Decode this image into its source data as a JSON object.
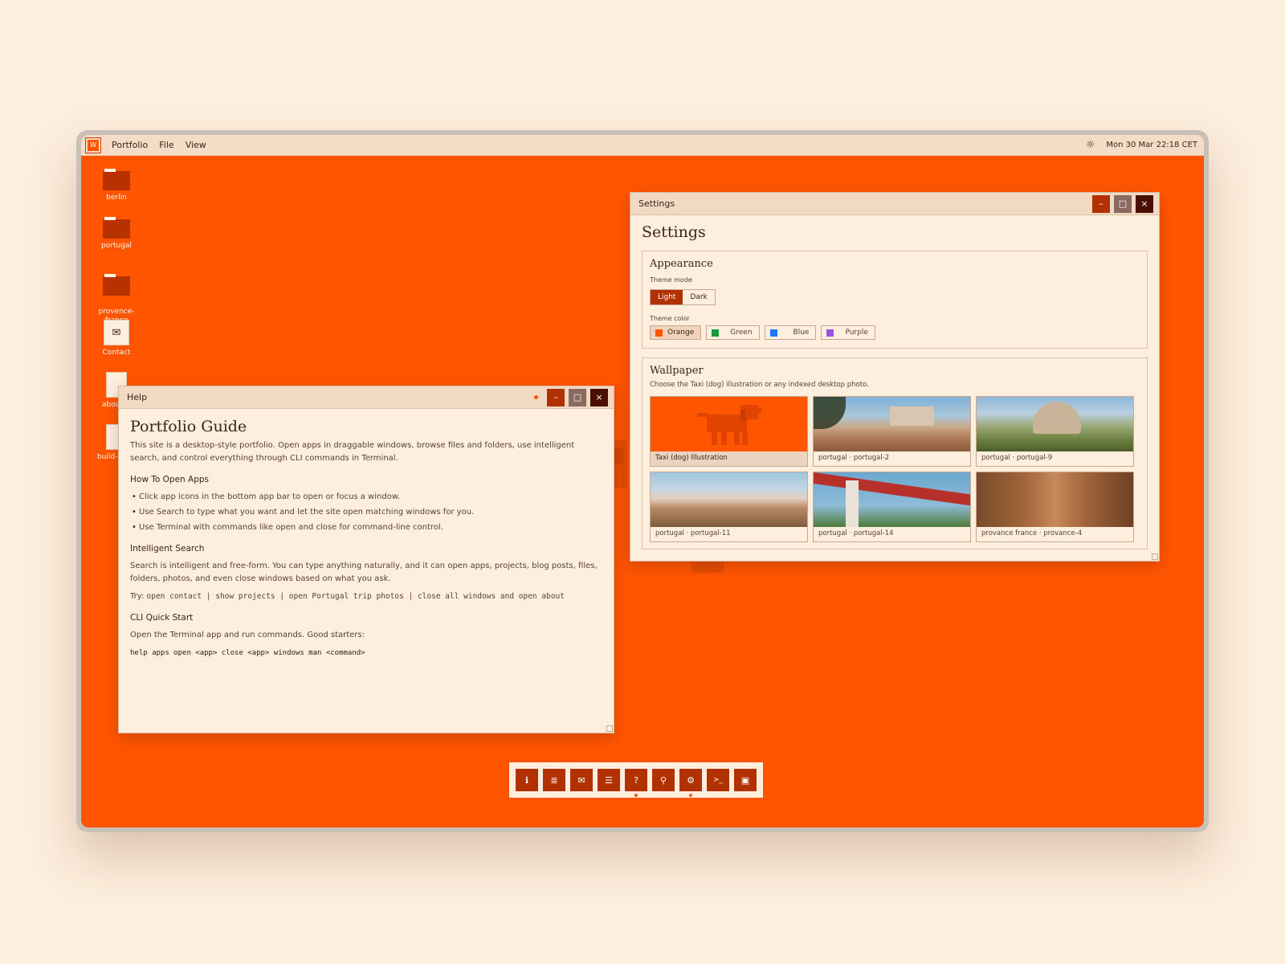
{
  "menubar": {
    "logo_glyph": "W",
    "items": [
      "Portfolio",
      "File",
      "View"
    ],
    "datetime": "Mon 30 Mar 22:18 CET",
    "brightness_icon": "sun-icon"
  },
  "desktop": {
    "icons": [
      {
        "label": "berlin",
        "type": "folder"
      },
      {
        "label": "portugal",
        "type": "folder"
      },
      {
        "label": "provence-\nfrance",
        "type": "folder"
      },
      {
        "label": "Contact",
        "type": "mail"
      },
      {
        "label": "about",
        "type": "document"
      },
      {
        "label": "build-lo",
        "type": "document"
      }
    ]
  },
  "help_window": {
    "title": "Help",
    "heading": "Portfolio Guide",
    "intro": "This site is a desktop-style portfolio. Open apps in draggable windows, browse files and folders, use intelligent search, and control everything through CLI commands in Terminal.",
    "sections": {
      "open_apps_title": "How To Open Apps",
      "open_apps_items": [
        "Click app icons in the bottom app bar to open or focus a window.",
        "Use Search to type what you want and let the site open matching windows for you.",
        "Use Terminal with commands like open and close for command-line control."
      ],
      "search_title": "Intelligent Search",
      "search_text": "Search is intelligent and free-form. You can type anything naturally, and it can open apps, projects, blog posts, files, folders, photos, and even close windows based on what you ask.",
      "try_label": "Try:",
      "try_examples": "open contact | show projects | open Portugal trip photos | close all windows and open about",
      "cli_title": "CLI Quick Start",
      "cli_text": "Open the Terminal app and run commands. Good starters:",
      "cli_commands": "help apps open <app> close <app> windows man <command>"
    }
  },
  "settings_window": {
    "title": "Settings",
    "heading": "Settings",
    "appearance": {
      "title": "Appearance",
      "theme_mode_label": "Theme mode",
      "modes": [
        "Light",
        "Dark"
      ],
      "selected_mode": "Light",
      "theme_color_label": "Theme color",
      "colors": [
        {
          "name": "Orange",
          "hex": "#ff5500",
          "selected": true
        },
        {
          "name": "Green",
          "hex": "#1a9a3a",
          "selected": false
        },
        {
          "name": "Blue",
          "hex": "#1e78ff",
          "selected": false
        },
        {
          "name": "Purple",
          "hex": "#9a55e0",
          "selected": false
        }
      ]
    },
    "wallpaper": {
      "title": "Wallpaper",
      "subtitle": "Choose the Taxi (dog) illustration or any indexed desktop photo.",
      "options": [
        {
          "caption": "Taxi (dog) Illustration",
          "selected": true
        },
        {
          "caption": "portugal · portugal-2",
          "selected": false
        },
        {
          "caption": "portugal · portugal-9",
          "selected": false
        },
        {
          "caption": "portugal · portugal-11",
          "selected": false
        },
        {
          "caption": "portugal · portugal-14",
          "selected": false
        },
        {
          "caption": "provance france · provance-4",
          "selected": false
        }
      ]
    }
  },
  "dock": {
    "apps": [
      {
        "name": "about",
        "icon": "info-icon",
        "glyph": "ℹ"
      },
      {
        "name": "blog",
        "icon": "document-icon",
        "glyph": "≣"
      },
      {
        "name": "contact",
        "icon": "mail-icon",
        "glyph": "✉"
      },
      {
        "name": "projects",
        "icon": "list-icon",
        "glyph": "☰"
      },
      {
        "name": "help",
        "icon": "help-icon",
        "glyph": "?",
        "open": true
      },
      {
        "name": "search",
        "icon": "search-icon",
        "glyph": "⚲"
      },
      {
        "name": "settings",
        "icon": "gear-icon",
        "glyph": "⚙",
        "open": true
      },
      {
        "name": "terminal",
        "icon": "terminal-icon",
        "glyph": ">_"
      },
      {
        "name": "briefcase",
        "icon": "briefcase-icon",
        "glyph": "▣"
      }
    ]
  },
  "colors": {
    "desktop": "#ff5500",
    "accent_dark": "#b13200",
    "window_bg": "#fdeedd"
  }
}
